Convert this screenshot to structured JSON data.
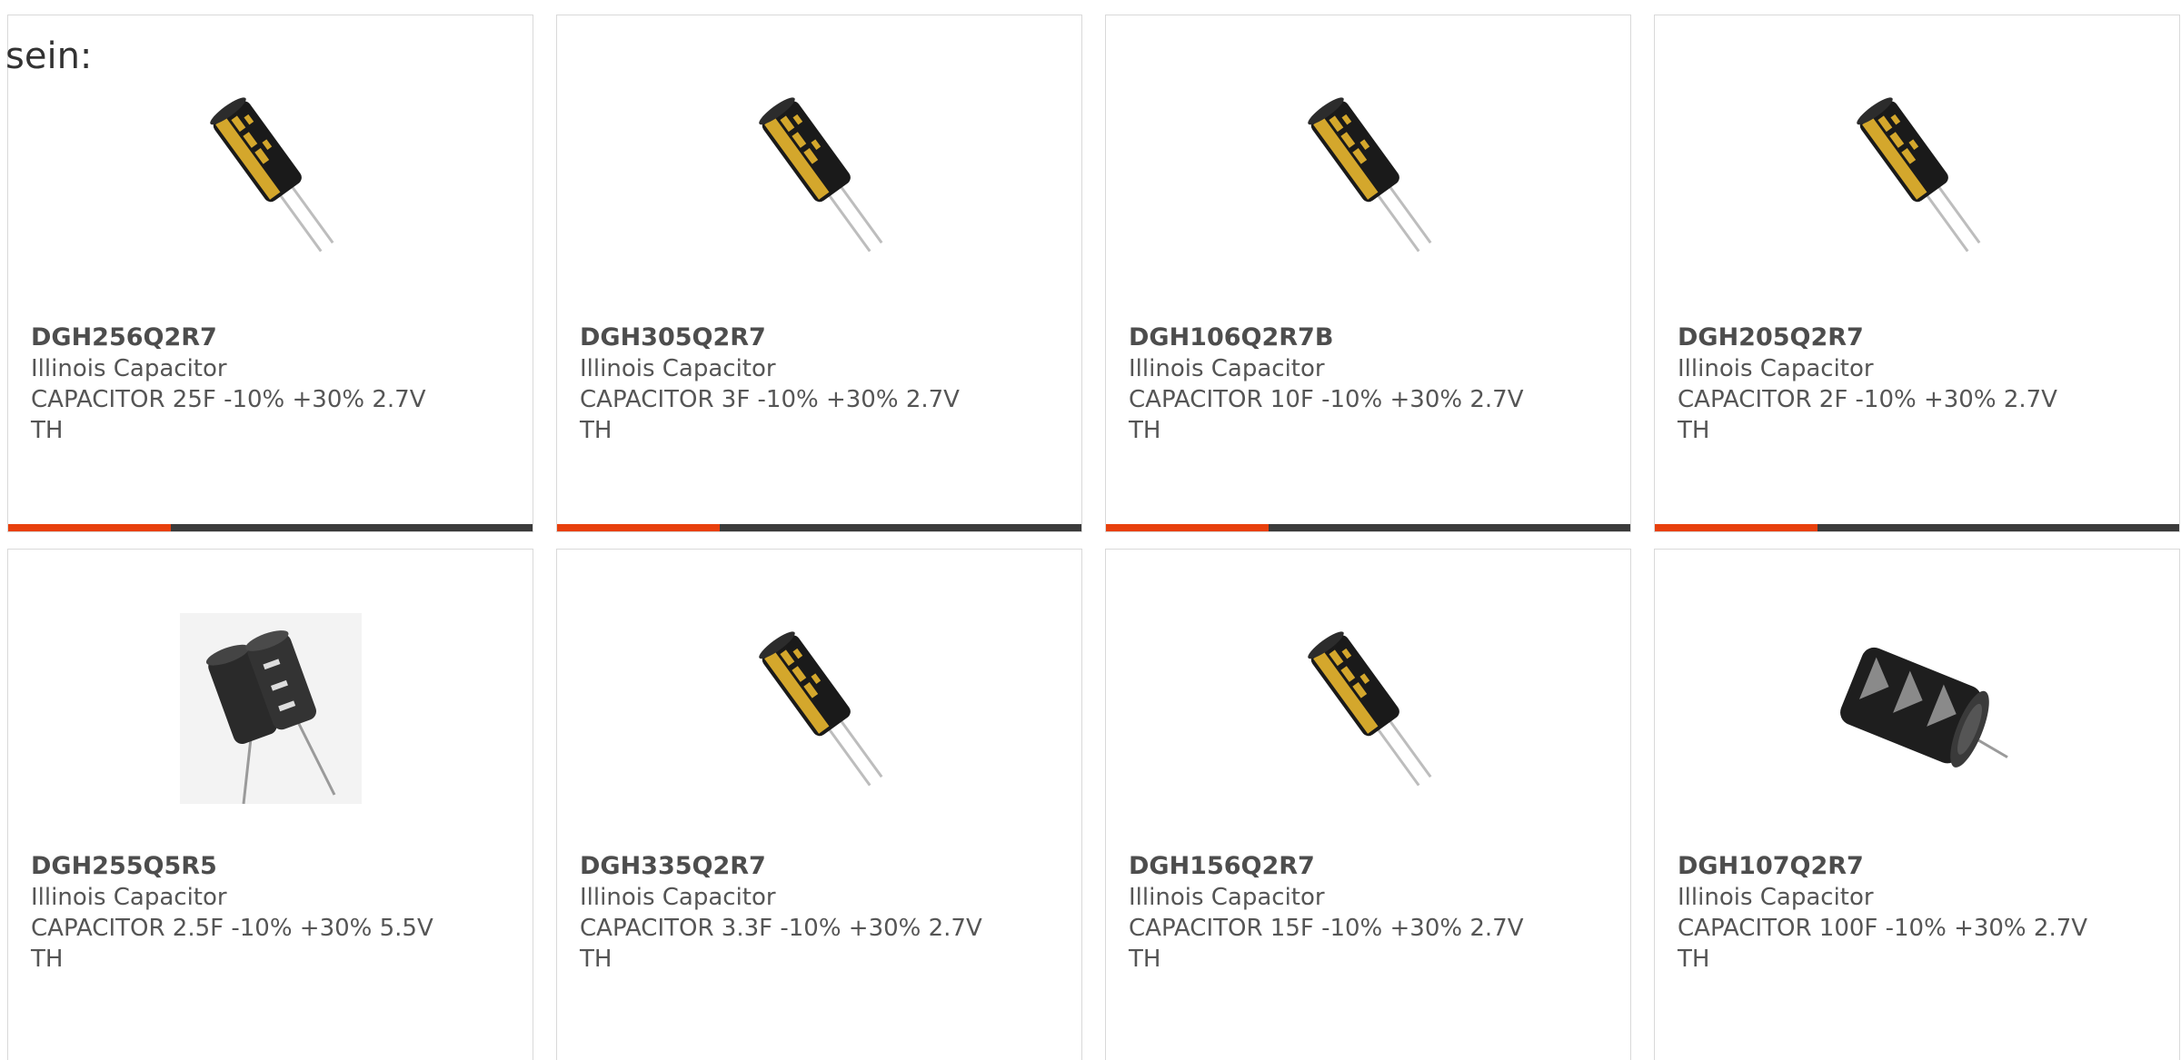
{
  "intro_text": "sein:",
  "colors": {
    "accent": "#e8400c",
    "bar_track": "#3b3b3b",
    "border": "#d9d9d9",
    "text": "#555555"
  },
  "products": [
    {
      "part_number": "DGH256Q2R7",
      "manufacturer": "Illinois Capacitor",
      "description": "CAPACITOR 25F -10% +30% 2.7V TH",
      "image": "black-gold-capacitor-image",
      "progress": 0.31
    },
    {
      "part_number": "DGH305Q2R7",
      "manufacturer": "Illinois Capacitor",
      "description": "CAPACITOR 3F -10% +30% 2.7V TH",
      "image": "black-gold-capacitor-image",
      "progress": 0.31
    },
    {
      "part_number": "DGH106Q2R7B",
      "manufacturer": "Illinois Capacitor",
      "description": "CAPACITOR 10F -10% +30% 2.7V TH",
      "image": "black-gold-capacitor-image",
      "progress": 0.31
    },
    {
      "part_number": "DGH205Q2R7",
      "manufacturer": "Illinois Capacitor",
      "description": "CAPACITOR 2F -10% +30% 2.7V TH",
      "image": "black-gold-capacitor-image",
      "progress": 0.31
    },
    {
      "part_number": "DGH255Q5R5",
      "manufacturer": "Illinois Capacitor",
      "description": "CAPACITOR 2.5F -10% +30% 5.5V TH",
      "image": "dual-cell-capacitor-image"
    },
    {
      "part_number": "DGH335Q2R7",
      "manufacturer": "Illinois Capacitor",
      "description": "CAPACITOR 3.3F -10% +30% 2.7V TH",
      "image": "black-gold-capacitor-image"
    },
    {
      "part_number": "DGH156Q2R7",
      "manufacturer": "Illinois Capacitor",
      "description": "CAPACITOR 15F -10% +30% 2.7V TH",
      "image": "black-gold-capacitor-image"
    },
    {
      "part_number": "DGH107Q2R7",
      "manufacturer": "Illinois Capacitor",
      "description": "CAPACITOR 100F -10% +30% 2.7V TH",
      "image": "large-black-capacitor-image"
    }
  ]
}
